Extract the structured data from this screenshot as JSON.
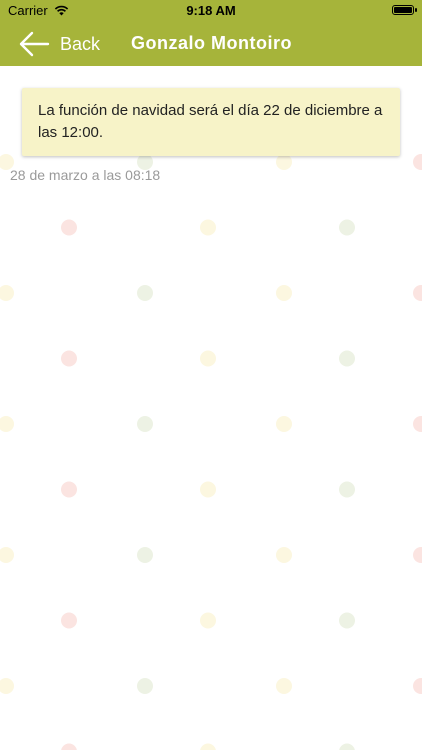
{
  "status_bar": {
    "carrier": "Carrier",
    "time": "9:18 AM"
  },
  "nav": {
    "back_label": "Back",
    "title": "Gonzalo Montoiro"
  },
  "message": {
    "text": "La función de navidad será el día 22 de diciembre a las 12:00.",
    "timestamp": "28 de marzo a las 08:18"
  },
  "colors": {
    "nav_background": "#a6b43a",
    "bubble_background": "#f7f3c8",
    "timestamp_text": "#9a9a9a",
    "dot_red": "#fbe4e1",
    "dot_yellow": "#fcf7e0",
    "dot_green": "#edf2e4"
  },
  "icons": {
    "back": "arrow-left-icon",
    "signal": "wifi-icon",
    "battery": "battery-icon"
  }
}
